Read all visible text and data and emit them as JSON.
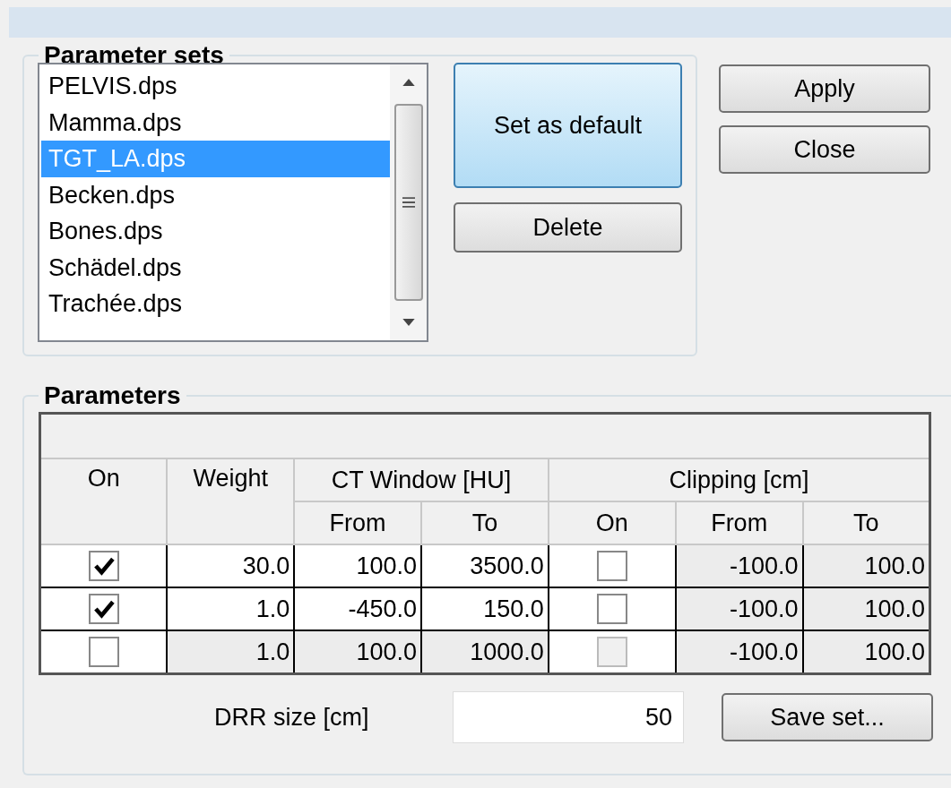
{
  "parameter_sets": {
    "title": "Parameter sets",
    "items": [
      {
        "label": "PELVIS.dps",
        "selected": false
      },
      {
        "label": "Mamma.dps",
        "selected": false
      },
      {
        "label": "TGT_LA.dps",
        "selected": true
      },
      {
        "label": "Becken.dps",
        "selected": false
      },
      {
        "label": "Bones.dps",
        "selected": false
      },
      {
        "label": "Schädel.dps",
        "selected": false
      },
      {
        "label": "Trachée.dps",
        "selected": false
      }
    ],
    "buttons": [
      {
        "label": "Set as default",
        "default": true
      },
      {
        "label": "Delete",
        "default": false
      }
    ]
  },
  "dialog_buttons": [
    {
      "label": "Apply"
    },
    {
      "label": "Close"
    }
  ],
  "parameters": {
    "title": "Parameters",
    "columns": {
      "on": "On",
      "weight": "Weight",
      "ct_window": "CT Window [HU]",
      "clipping": "Clipping [cm]",
      "ct_from": "From",
      "ct_to": "To",
      "clip_on": "On",
      "clip_from": "From",
      "clip_to": "To"
    },
    "rows": [
      {
        "on": true,
        "weight": "30.0",
        "ct_from": "100.0",
        "ct_to": "3500.0",
        "clip_on": false,
        "clip_from": "-100.0",
        "clip_to": "100.0"
      },
      {
        "on": true,
        "weight": "1.0",
        "ct_from": "-450.0",
        "ct_to": "150.0",
        "clip_on": false,
        "clip_from": "-100.0",
        "clip_to": "100.0"
      },
      {
        "on": false,
        "weight": "1.0",
        "ct_from": "100.0",
        "ct_to": "1000.0",
        "clip_on": false,
        "clip_from": "-100.0",
        "clip_to": "100.0"
      }
    ],
    "drr_size": {
      "label": "DRR size [cm]",
      "value": "50"
    },
    "save_button": "Save set..."
  }
}
